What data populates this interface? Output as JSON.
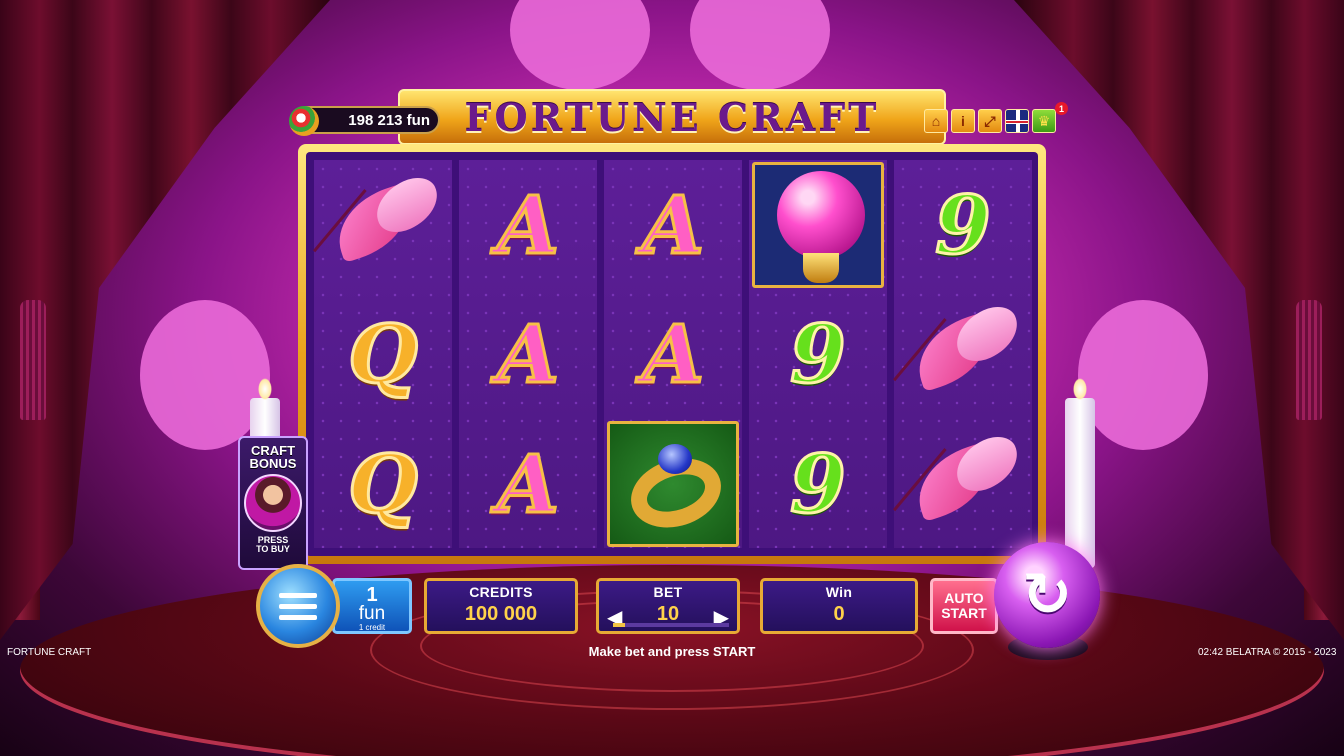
{
  "header": {
    "title": "FORTUNE CRAFT",
    "balance": "198 213 fun",
    "tools": [
      "home-icon",
      "paytable-icon",
      "fullscreen-icon",
      "uk-flag-icon",
      "trophy-icon"
    ],
    "trophy_badge": "1"
  },
  "reels": [
    [
      "feather",
      "Q",
      "Q"
    ],
    [
      "A",
      "A",
      "A"
    ],
    [
      "A",
      "A",
      "ring"
    ],
    [
      "orb",
      "9",
      "9"
    ],
    [
      "9",
      "feather",
      "feather"
    ]
  ],
  "symbols": {
    "A": "A",
    "Q": "Q",
    "nine": "9"
  },
  "craft_bonus": {
    "title_line1": "CRAFT",
    "title_line2": "BONUS",
    "press_line1": "PRESS",
    "press_line2": "TO BUY"
  },
  "controls": {
    "lines": {
      "value": "1",
      "unit": "fun",
      "sub": "1 credit"
    },
    "credits": {
      "label": "CREDITS",
      "value": "100 000"
    },
    "bet": {
      "label": "BET",
      "value": "10",
      "left_arrow": "◀",
      "right_arrow": "▶",
      "level": 0.1
    },
    "win": {
      "label": "Win",
      "value": "0"
    },
    "auto_start": {
      "line1": "AUTO",
      "line2": "START"
    },
    "spin_glyph": "↻"
  },
  "status_text": "Make bet and press START",
  "footer": {
    "game_name": "FORTUNE CRAFT",
    "clock": "02:42  BELATRA © 2015 - 2023"
  },
  "colors": {
    "accent": "#e7aa35",
    "panel": "#24105c",
    "reel_bg": "#521c8c"
  }
}
